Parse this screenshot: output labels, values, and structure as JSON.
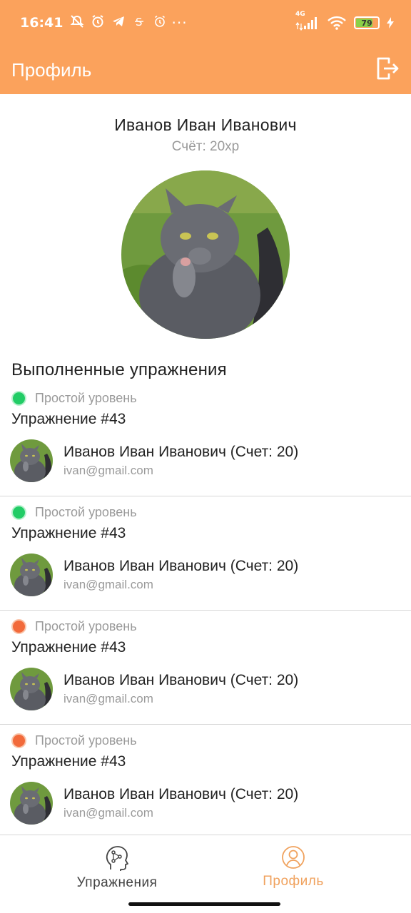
{
  "status_bar": {
    "time": "16:41",
    "network": "4G",
    "battery": "79",
    "battery_level": 0.79,
    "left_icons": [
      "mute-bell-icon",
      "alarm-icon",
      "telegram-icon",
      "sim-icon",
      "alarm-small-icon"
    ],
    "overflow": "···"
  },
  "header": {
    "title": "Профиль",
    "logout_icon": "logout-icon"
  },
  "profile": {
    "name": "Иванов Иван Иванович",
    "score": "Счёт: 20xp"
  },
  "section_title": "Выполненные упражнения",
  "colors": {
    "accent": "#FBA25C",
    "green": "#22CC66",
    "red": "#F26A3B"
  },
  "exercises": [
    {
      "level": "Простой уровень",
      "status_color": "green",
      "title": "Упражнение #43",
      "user_name": "Иванов Иван Иванович (Счет: 20)",
      "email": "ivan@gmail.com"
    },
    {
      "level": "Простой уровень",
      "status_color": "green",
      "title": "Упражнение #43",
      "user_name": "Иванов Иван Иванович (Счет: 20)",
      "email": "ivan@gmail.com"
    },
    {
      "level": "Простой уровень",
      "status_color": "red",
      "title": "Упражнение #43",
      "user_name": "Иванов Иван Иванович (Счет: 20)",
      "email": "ivan@gmail.com"
    },
    {
      "level": "Простой уровень",
      "status_color": "red",
      "title": "Упражнение #43",
      "user_name": "Иванов Иван Иванович (Счет: 20)",
      "email": "ivan@gmail.com"
    }
  ],
  "bottom_nav": {
    "exercises_label": "Упражнения",
    "profile_label": "Профиль",
    "active": "profile"
  }
}
